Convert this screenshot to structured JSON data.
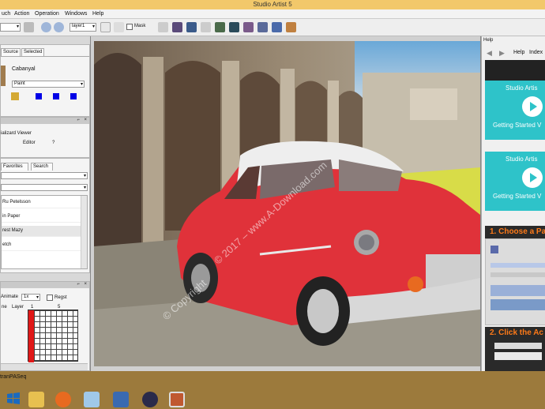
{
  "window": {
    "title": "Studio Artist 5"
  },
  "menu": [
    "uch",
    "Action",
    "Operation",
    "Windows",
    "Help"
  ],
  "toolbar": {
    "layer_combo": "layer1",
    "mask_label": "Mask"
  },
  "source_panel": {
    "tabs": [
      "Source",
      "Selected"
    ],
    "name": "Cabanyal",
    "preset_combo": "Paint"
  },
  "preview_panel": {
    "title": "ializard Viewer",
    "label": "Editor",
    "value": "?"
  },
  "library_panel": {
    "tabs": [
      "Favorites",
      "Search"
    ],
    "items": [
      "Ru Petelsson",
      "in Paper",
      "rest Mazy",
      "etch"
    ]
  },
  "sequence_panel": {
    "label": "Animate",
    "field": "1x",
    "checkbox_label": "Regst",
    "col_headers": [
      "ne",
      "Layer",
      "1",
      "5"
    ],
    "footer": "tranPASeq"
  },
  "canvas": {
    "watermark": "© 2017 – www.A-Download.com",
    "watermark2": "© Copyright"
  },
  "help": {
    "header": "Help",
    "links": [
      "Help",
      "Index"
    ],
    "video_title": "Studio Artis",
    "video_sub": "Getting Started V",
    "step1": "1. Choose a Pa",
    "step2": "2. Click the Ac"
  },
  "colors": {
    "titlebar": "#f2c86a",
    "taskbar": "#9c7a3c",
    "help_teal": "#2ec3c9",
    "step_orange": "#ff7a18",
    "car_red": "#e0323a",
    "grid_red": "#e01818"
  },
  "taskbar": {
    "icons": [
      "file-explorer-icon",
      "firefox-icon",
      "app-icon",
      "network-icon",
      "media-icon",
      "studio-artist-icon"
    ]
  }
}
